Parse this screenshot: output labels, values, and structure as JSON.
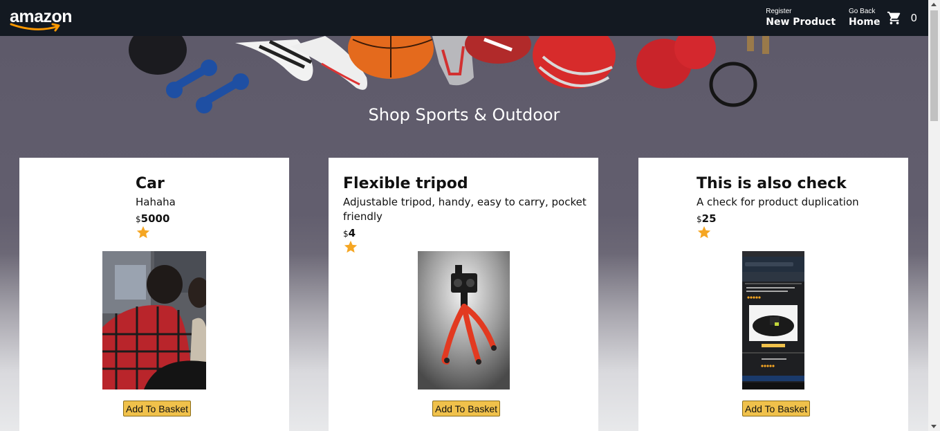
{
  "header": {
    "logo_text": "amazon",
    "nav": [
      {
        "line1": "Register",
        "line2": "New Product"
      },
      {
        "line1": "Go Back",
        "line2": "Home"
      }
    ],
    "basket_count": "0"
  },
  "hero": {
    "title": "Shop Sports & Outdoor"
  },
  "products": [
    {
      "title": "Car",
      "description": "Hahaha",
      "currency": "$",
      "price": "5000",
      "rating": 1,
      "image": "photo-of-person-icon",
      "button": "Add To Basket"
    },
    {
      "title": "Flexible tripod",
      "description": "Adjustable tripod, handy, easy to carry, pocket friendly",
      "currency": "$",
      "price": "4",
      "rating": 1,
      "image": "tripod-icon",
      "button": "Add To Basket"
    },
    {
      "title": "This is also check",
      "description": "A check for product duplication",
      "currency": "$",
      "price": "25",
      "rating": 1,
      "image": "phone-screenshot-icon",
      "button": "Add To Basket"
    }
  ],
  "colors": {
    "header_bg": "#131921",
    "button_bg": "#f0c14b",
    "star": "#f5a623",
    "logo_smile": "#ff9900"
  }
}
